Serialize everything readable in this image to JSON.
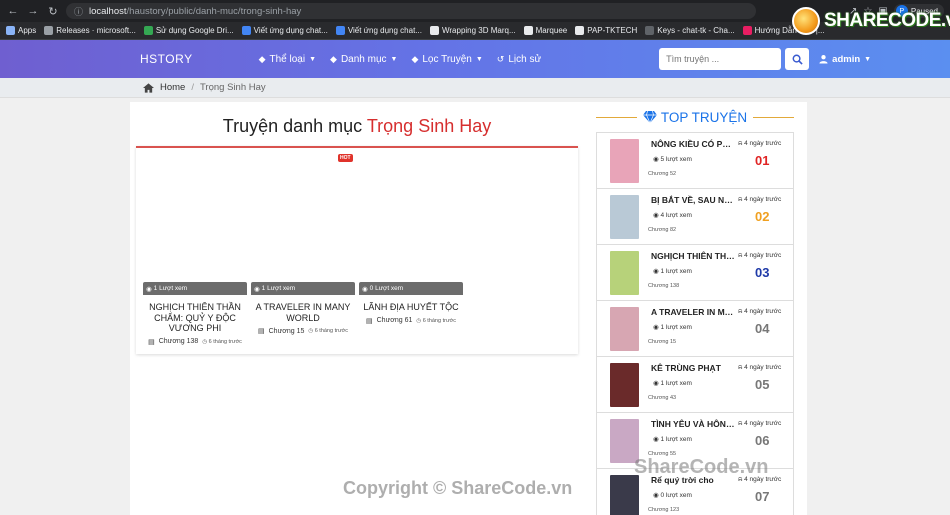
{
  "browser": {
    "url_host": "localhost",
    "url_path": "/haustory/public/danh-muc/trong-sinh-hay",
    "profile_initial": "P",
    "profile_status": "Paused",
    "bookmarks": [
      {
        "label": "Apps",
        "color": "#8ab4f8"
      },
      {
        "label": "Releases · microsoft...",
        "color": "#9aa0a6"
      },
      {
        "label": "Sử dụng Google Dri...",
        "color": "#34a853"
      },
      {
        "label": "Viết ứng dụng chat...",
        "color": "#4285f4"
      },
      {
        "label": "Viết ứng dụng chat...",
        "color": "#4285f4"
      },
      {
        "label": "Wrapping 3D Marq...",
        "color": "#e8eaed"
      },
      {
        "label": "Marquee",
        "color": "#e8eaed"
      },
      {
        "label": "PAP-TKTECH",
        "color": "#e8eaed"
      },
      {
        "label": "Keys - chat-tk - Cha...",
        "color": "#5f6368"
      },
      {
        "label": "Hướng Dẫn Test |...",
        "color": "#e91e63"
      }
    ]
  },
  "navbar": {
    "brand": "HSTORY",
    "menu": [
      {
        "label": "Thể loại",
        "icon": "tag-icon",
        "dropdown": true
      },
      {
        "label": "Danh mục",
        "icon": "tag-icon",
        "dropdown": true
      },
      {
        "label": "Lọc Truyện",
        "icon": "tag-icon",
        "dropdown": true
      },
      {
        "label": "Lịch sử",
        "icon": "history-icon",
        "dropdown": false
      }
    ],
    "search_placeholder": "Tìm truyện ...",
    "user": "admin"
  },
  "breadcrumb": {
    "home": "Home",
    "current": "Trọng Sinh Hay"
  },
  "category": {
    "title_prefix": "Truyện danh mục",
    "title_highlight": "Trọng Sinh Hay",
    "hot_badge": "HOT",
    "stories": [
      {
        "views": "1 Lượt xem",
        "name": "NGHỊCH THIÊN THẦN CHẨM: QUỶ Y ĐỘC VƯƠNG PHI",
        "chapter": "Chương 138",
        "time": "6 tháng trước"
      },
      {
        "views": "1 Lượt xem",
        "name": "A TRAVELER IN MANY WORLD",
        "chapter": "Chương 15",
        "time": "6 tháng trước"
      },
      {
        "views": "0 Lượt xem",
        "name": "LÃNH ĐỊA HUYẾT TỘC",
        "chapter": "Chương 61",
        "time": "6 tháng trước"
      }
    ]
  },
  "top": {
    "heading": "TOP TRUYỆN",
    "items": [
      {
        "name": "NÔNG KIỀU CÓ PHÚC",
        "ago": "4 ngày trước",
        "views": "5 lượt xem",
        "chapter": "Chương 52",
        "rank": "01",
        "rank_color": "#e02424",
        "cover": "#e8a4b8"
      },
      {
        "name": "BỊ BẮT VỀ, SAU NÀNG",
        "ago": "4 ngày trước",
        "views": "4 lượt xem",
        "chapter": "Chương 82",
        "rank": "02",
        "rank_color": "#f0a020",
        "cover": "#b9c9d6"
      },
      {
        "name": "NGHỊCH THIÊN THẦN",
        "ago": "4 ngày trước",
        "views": "1 lượt xem",
        "chapter": "Chương 138",
        "rank": "03",
        "rank_color": "#1f3aa8",
        "cover": "#b7d27a"
      },
      {
        "name": "A TRAVELER IN MANY",
        "ago": "4 ngày trước",
        "views": "1 lượt xem",
        "chapter": "Chương 15",
        "rank": "04",
        "rank_color": "#777777",
        "cover": "#d7a6b2"
      },
      {
        "name": "KÊ TRÙNG PHẠT",
        "ago": "4 ngày trước",
        "views": "1 lượt xem",
        "chapter": "Chương 43",
        "rank": "05",
        "rank_color": "#777777",
        "cover": "#6a2a2a"
      },
      {
        "name": "TÌNH YÊU VÀ HÔN NHÂN",
        "ago": "4 ngày trước",
        "views": "1 lượt xem",
        "chapter": "Chương 55",
        "rank": "06",
        "rank_color": "#777777",
        "cover": "#c9a8c4"
      },
      {
        "name": "Rể quý trời cho",
        "ago": "4 ngày trước",
        "views": "0 lượt xem",
        "chapter": "Chương 123",
        "rank": "07",
        "rank_color": "#777777",
        "cover": "#3a3a4a"
      }
    ]
  },
  "watermark": {
    "logo_text": "SHARECODE.vn",
    "center_text": "ShareCode.vn",
    "bottom_text": "Copyright © ShareCode.vn"
  }
}
